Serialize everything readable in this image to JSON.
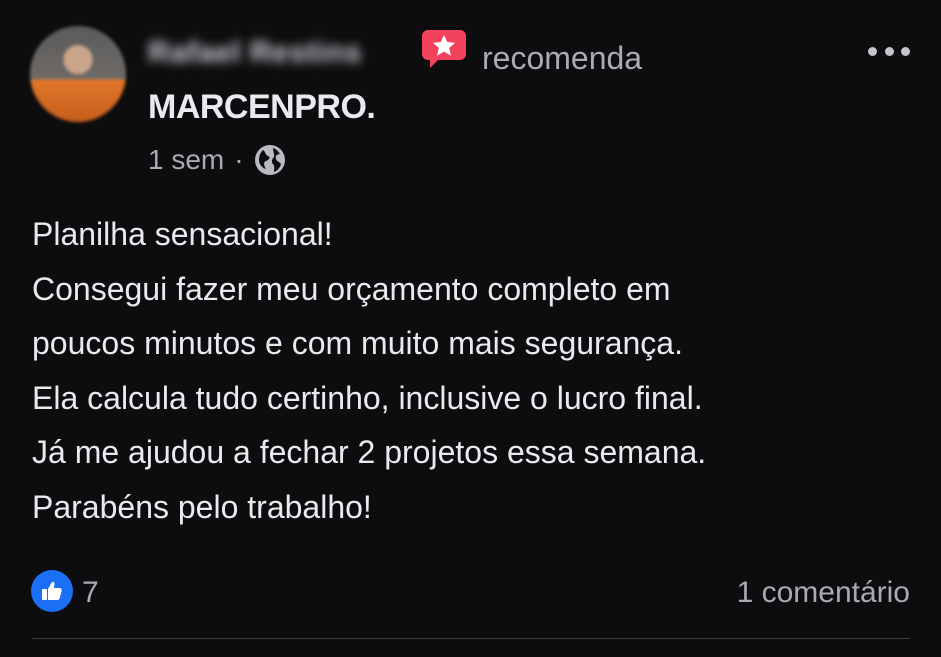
{
  "post": {
    "author_name": "Rafael Restins",
    "action_text": "recomenda",
    "page_name": "MARCENPRO.",
    "time_ago": "1 sem",
    "separator": "·",
    "privacy_icon": "globe-icon",
    "body_lines": [
      "Planilha sensacional!",
      "Consegui fazer meu orçamento completo em",
      "poucos minutos e com muito mais segurança.",
      "Ela calcula tudo certinho, inclusive o lucro final.",
      "Já me ajudou a fechar 2 projetos essa semana.",
      "Parabéns pelo trabalho!"
    ]
  },
  "reactions": {
    "icon": "like-icon",
    "count": "7",
    "comments_label": "1 comentário"
  },
  "colors": {
    "background": "#0d0d0f",
    "recommend_badge": "#f2425c",
    "like_blue": "#1b6ff5"
  }
}
